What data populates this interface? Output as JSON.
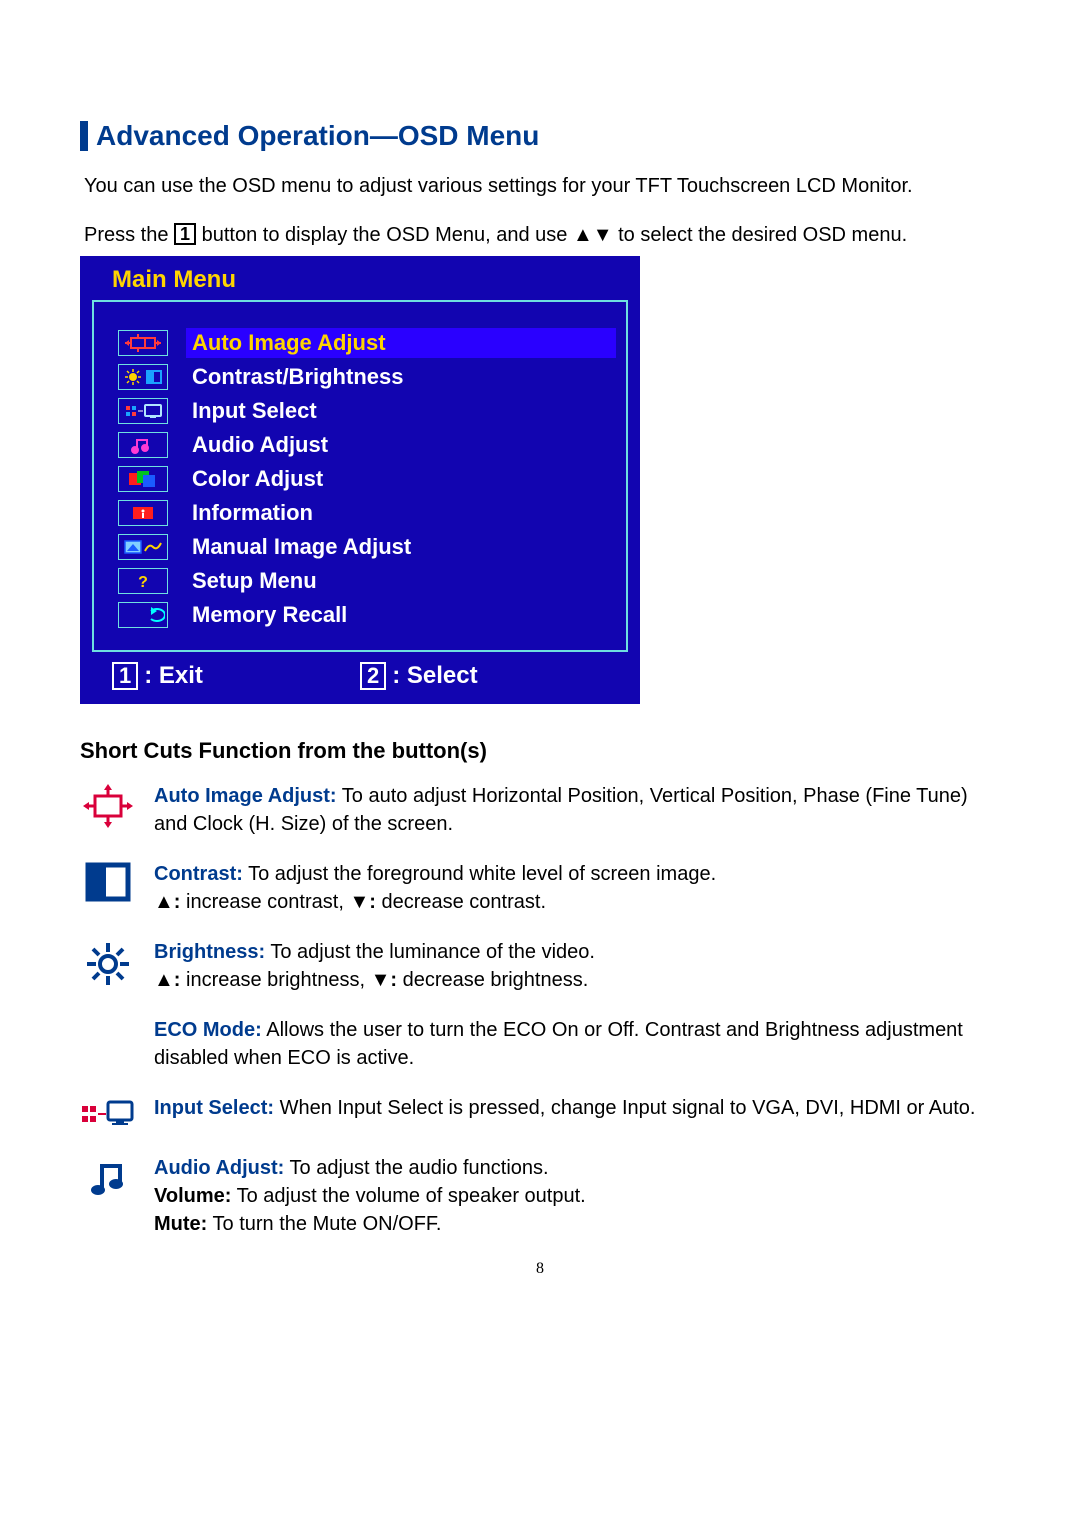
{
  "heading": "Advanced Operation—OSD Menu",
  "intro_line1": "You can use the OSD menu to adjust various settings for your TFT Touchscreen LCD Monitor.",
  "intro_press_the": "Press the ",
  "intro_button_key": "1",
  "intro_after_key": " button to display the OSD Menu, and use ▲▼ to select the desired OSD menu.",
  "osd": {
    "title": "Main Menu",
    "items": [
      {
        "label": "Auto Image Adjust",
        "selected": true
      },
      {
        "label": "Contrast/Brightness",
        "selected": false
      },
      {
        "label": "Input Select",
        "selected": false
      },
      {
        "label": "Audio Adjust",
        "selected": false
      },
      {
        "label": "Color Adjust",
        "selected": false
      },
      {
        "label": "Information",
        "selected": false
      },
      {
        "label": "Manual Image Adjust",
        "selected": false
      },
      {
        "label": "Setup Menu",
        "selected": false
      },
      {
        "label": "Memory Recall",
        "selected": false
      }
    ],
    "footer": {
      "key1": "1",
      "label1": ": Exit",
      "key2": "2",
      "label2": ": Select"
    }
  },
  "subheading": "Short Cuts Function from the button(s)",
  "shortcuts": {
    "auto": {
      "title": "Auto Image Adjust:",
      "body": " To auto adjust Horizontal Position, Vertical Position, Phase (Fine Tune) and Clock (H. Size) of the screen."
    },
    "contrast": {
      "title": "Contrast:",
      "body": " To adjust the foreground white level of screen image.",
      "line2_up": "▲:",
      "line2_up_txt": " increase contrast, ",
      "line2_dn": "▼:",
      "line2_dn_txt": " decrease contrast."
    },
    "brightness": {
      "title": "Brightness:",
      "body": " To adjust the luminance of the video.",
      "line2_up": "▲:",
      "line2_up_txt": " increase brightness, ",
      "line2_dn": "▼:",
      "line2_dn_txt": " decrease brightness."
    },
    "eco": {
      "title": "ECO Mode:",
      "body": " Allows the user to turn the ECO On or Off. Contrast and Brightness adjustment disabled when ECO is active."
    },
    "input": {
      "title": "Input Select:",
      "body": " When Input Select is pressed, change Input signal to VGA, DVI, HDMI or Auto."
    },
    "audio": {
      "title": "Audio Adjust:",
      "body": " To adjust the audio functions.",
      "vol_t": "Volume:",
      "vol_b": " To adjust the volume of speaker output.",
      "mute_t": "Mute:",
      "mute_b": " To turn the Mute ON/OFF."
    }
  },
  "page_number": "8"
}
